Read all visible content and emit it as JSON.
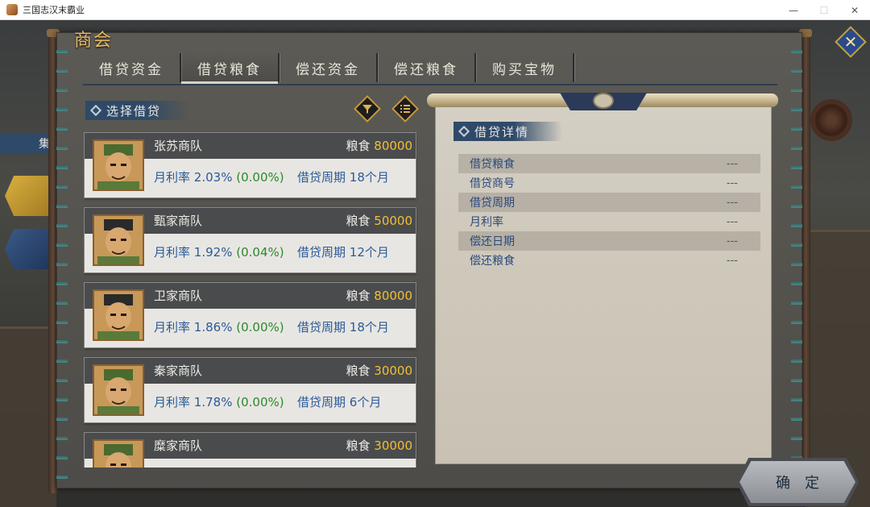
{
  "window": {
    "title": "三国志汉末霸业",
    "minimize": "—",
    "maximize": "☐",
    "close": "✕"
  },
  "panel": {
    "title": "商会"
  },
  "tabs": [
    {
      "label": "借贷资金"
    },
    {
      "label": "借贷粮食"
    },
    {
      "label": "偿还资金"
    },
    {
      "label": "偿还粮食"
    },
    {
      "label": "购买宝物"
    }
  ],
  "active_tab": "借贷粮食",
  "left_section": {
    "title": "选择借贷"
  },
  "icons": {
    "filter": "filter-icon",
    "list": "list-icon",
    "close": "close-icon"
  },
  "loans": [
    {
      "name": "张苏商队",
      "grain_label": "粮食",
      "grain_amount": "80000",
      "rate_label": "月利率",
      "rate": "2.03%",
      "rate_change": "(0.00%)",
      "period_label": "借贷周期",
      "period": "18个月"
    },
    {
      "name": "甄家商队",
      "grain_label": "粮食",
      "grain_amount": "50000",
      "rate_label": "月利率",
      "rate": "1.92%",
      "rate_change": "(0.04%)",
      "period_label": "借贷周期",
      "period": "12个月"
    },
    {
      "name": "卫家商队",
      "grain_label": "粮食",
      "grain_amount": "80000",
      "rate_label": "月利率",
      "rate": "1.86%",
      "rate_change": "(0.00%)",
      "period_label": "借贷周期",
      "period": "18个月"
    },
    {
      "name": "秦家商队",
      "grain_label": "粮食",
      "grain_amount": "30000",
      "rate_label": "月利率",
      "rate": "1.78%",
      "rate_change": "(0.00%)",
      "period_label": "借贷周期",
      "period": "6个月"
    },
    {
      "name": "糜家商队",
      "grain_label": "粮食",
      "grain_amount": "30000",
      "rate_label": "",
      "rate": "",
      "rate_change": "",
      "period_label": "",
      "period": ""
    }
  ],
  "detail": {
    "title": "借贷详情",
    "rows": [
      {
        "label": "借贷粮食",
        "value": "---"
      },
      {
        "label": "借贷商号",
        "value": "---"
      },
      {
        "label": "借贷周期",
        "value": "---"
      },
      {
        "label": "月利率",
        "value": "---"
      },
      {
        "label": "偿还日期",
        "value": "---"
      },
      {
        "label": "偿还粮食",
        "value": "---"
      }
    ]
  },
  "side": {
    "tab_label": "集"
  },
  "confirm": {
    "label": "确定"
  },
  "colors": {
    "title_gold": "#e8b860",
    "grain_amount": "#f0c030",
    "rate_blue": "#2a5a9a",
    "rate_change_green": "#2a8a2a"
  }
}
